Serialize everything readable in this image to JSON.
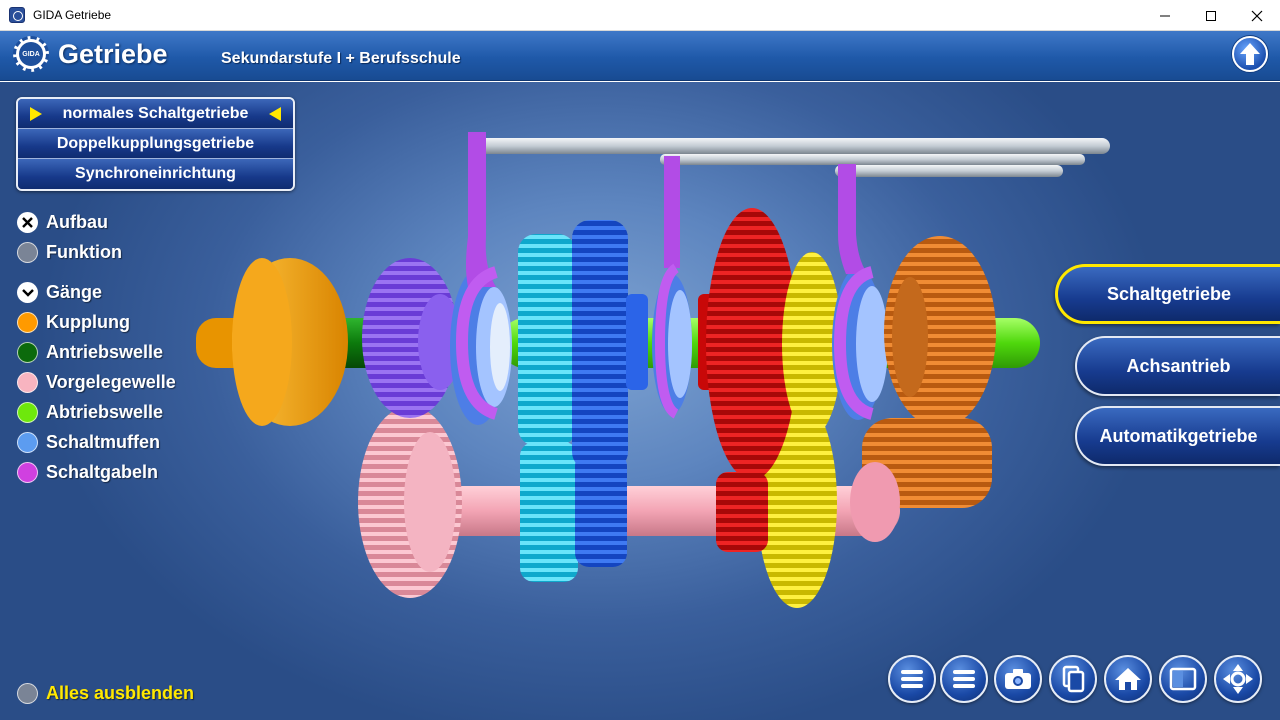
{
  "window": {
    "title": "GIDA Getriebe"
  },
  "header": {
    "logo_text": "GIDA",
    "title": "Getriebe",
    "subtitle": "Sekundarstufe I + Berufsschule"
  },
  "menu": {
    "items": [
      {
        "label": "normales Schaltgetriebe",
        "selected": true
      },
      {
        "label": "Doppelkupplungsgetriebe",
        "selected": false
      },
      {
        "label": "Synchroneinrichtung",
        "selected": false
      }
    ]
  },
  "legend": {
    "aufbau": "Aufbau",
    "funktion": "Funktion",
    "gaenge": "Gänge",
    "items": [
      {
        "label": "Kupplung",
        "color": "#ff9a00"
      },
      {
        "label": "Antriebswelle",
        "color": "#0c6a0c"
      },
      {
        "label": "Vorgelegewelle",
        "color": "#f8b4c0"
      },
      {
        "label": "Abtriebswelle",
        "color": "#6ee80c"
      },
      {
        "label": "Schaltmuffen",
        "color": "#5c9cf0"
      },
      {
        "label": "Schaltgabeln",
        "color": "#d040e0"
      }
    ],
    "hide_all": "Alles ausblenden"
  },
  "right_menu": {
    "items": [
      {
        "label": "Schaltgetriebe",
        "active": true
      },
      {
        "label": "Achsantrieb",
        "active": false
      },
      {
        "label": "Automatikgetriebe",
        "active": false
      }
    ]
  },
  "colors": {
    "header_blue": "#1f59a9",
    "highlight_yellow": "#ffe800",
    "clutch": "#ffa800",
    "gear_purple": "#7a4ae6",
    "gear_cyan": "#18c8e8",
    "gear_blue": "#1c58e0",
    "gear_red": "#d80c0c",
    "gear_yellow": "#f0e000",
    "gear_orange": "#e0741c",
    "gear_pink": "#f6a8b8",
    "fork_purple": "#b040e0"
  },
  "toolbar": {
    "icons": [
      "menu-icon",
      "list-icon",
      "camera-icon",
      "pages-icon",
      "home-icon",
      "window-icon",
      "move-icon"
    ]
  }
}
